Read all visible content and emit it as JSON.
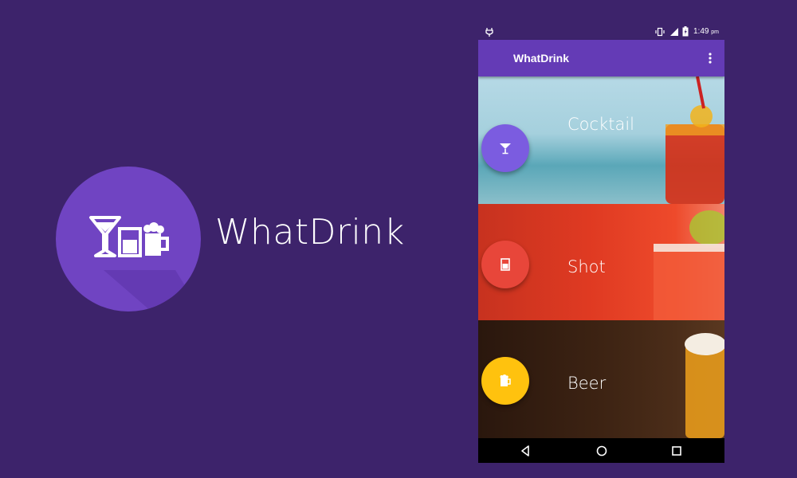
{
  "brand": {
    "name": "WhatDrink",
    "logo_icon": "drinks-icon",
    "logo_color": "#7044c2"
  },
  "status_bar": {
    "icons": [
      "android-debug-icon",
      "vibrate-icon",
      "signal-icon",
      "battery-charging-icon"
    ],
    "time": "1:49",
    "ampm": "pm"
  },
  "app_bar": {
    "title": "WhatDrink",
    "menu_icon": "more-vert-icon",
    "color": "#643bb6"
  },
  "categories": [
    {
      "label": "Cocktail",
      "icon": "cocktail-icon",
      "fab_color": "#7b5ce0"
    },
    {
      "label": "Shot",
      "icon": "shot-glass-icon",
      "fab_color": "#e8463a"
    },
    {
      "label": "Beer",
      "icon": "beer-mug-icon",
      "fab_color": "#ffc20e"
    }
  ],
  "nav_bar": {
    "buttons": [
      "back-icon",
      "home-icon",
      "recents-icon"
    ]
  }
}
